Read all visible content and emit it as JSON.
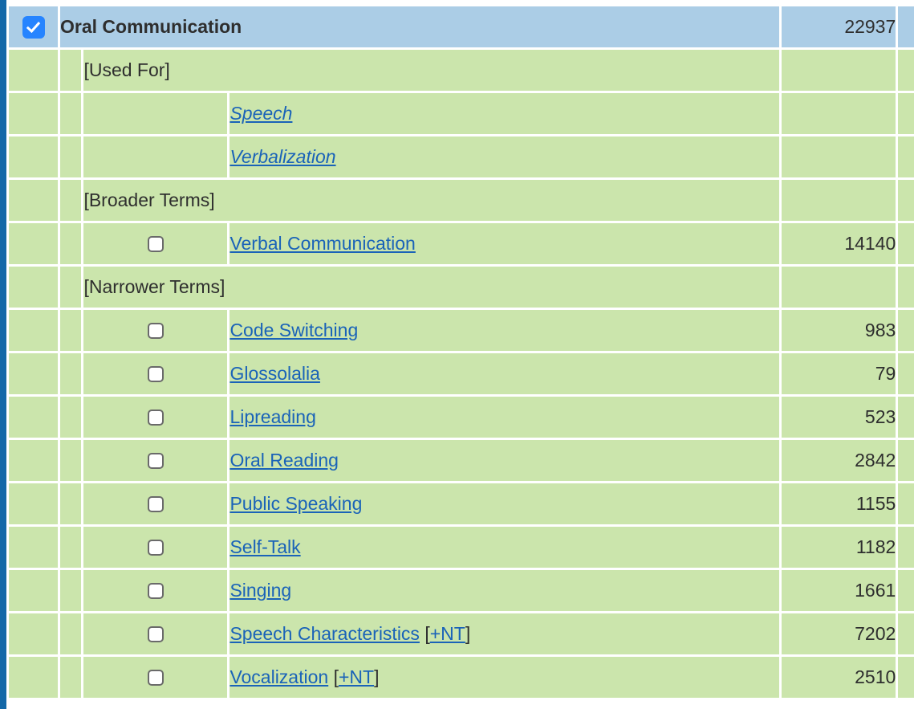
{
  "colors": {
    "header_row_bg": "#abcde6",
    "row_bg": "#cbe5ac",
    "link": "#1a63b8",
    "left_rail": "#1368a8",
    "checkbox_checked": "#2684ff",
    "text": "#2e2e2e"
  },
  "header": {
    "term": "Oral Communication",
    "count": "22937",
    "checked": true
  },
  "sections": [
    {
      "label": "[Used For]",
      "entries": [
        {
          "term": "Speech",
          "count": "",
          "italic": true,
          "checkbox": false,
          "nt": false
        },
        {
          "term": "Verbalization",
          "count": "",
          "italic": true,
          "checkbox": false,
          "nt": false
        }
      ]
    },
    {
      "label": "[Broader Terms]",
      "entries": [
        {
          "term": "Verbal Communication",
          "count": "14140",
          "italic": false,
          "checkbox": true,
          "nt": false
        }
      ]
    },
    {
      "label": "[Narrower Terms]",
      "entries": [
        {
          "term": "Code Switching",
          "count": "983",
          "italic": false,
          "checkbox": true,
          "nt": false
        },
        {
          "term": "Glossolalia",
          "count": "79",
          "italic": false,
          "checkbox": true,
          "nt": false
        },
        {
          "term": "Lipreading",
          "count": "523",
          "italic": false,
          "checkbox": true,
          "nt": false
        },
        {
          "term": "Oral Reading",
          "count": "2842",
          "italic": false,
          "checkbox": true,
          "nt": false
        },
        {
          "term": "Public Speaking",
          "count": "1155",
          "italic": false,
          "checkbox": true,
          "nt": false
        },
        {
          "term": "Self-Talk",
          "count": "1182",
          "italic": false,
          "checkbox": true,
          "nt": false
        },
        {
          "term": "Singing",
          "count": "1661",
          "italic": false,
          "checkbox": true,
          "nt": false
        },
        {
          "term": "Speech Characteristics",
          "count": "7202",
          "italic": false,
          "checkbox": true,
          "nt": true
        },
        {
          "term": "Vocalization",
          "count": "2510",
          "italic": false,
          "checkbox": true,
          "nt": true
        }
      ]
    }
  ],
  "nt_marker": {
    "open_bracket": "[",
    "link_text": "+NT",
    "close_bracket": "]"
  }
}
